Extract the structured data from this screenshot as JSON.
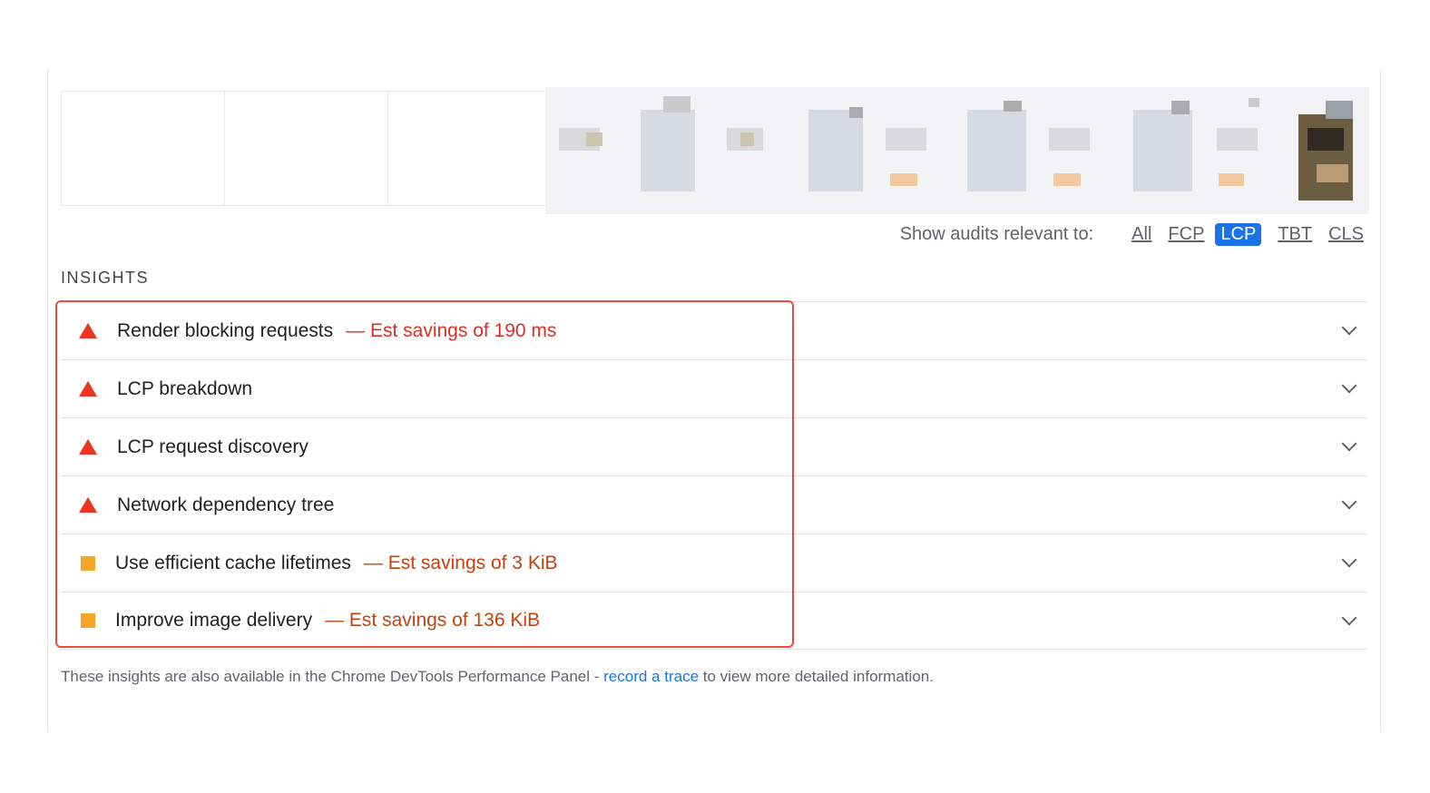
{
  "filter": {
    "label": "Show audits relevant to:",
    "options": [
      "All",
      "FCP",
      "LCP",
      "TBT",
      "CLS"
    ],
    "active": "LCP"
  },
  "section_title": "INSIGHTS",
  "insights": [
    {
      "severity": "fail",
      "title": "Render blocking requests",
      "savings": "— Est savings of 190 ms"
    },
    {
      "severity": "fail",
      "title": "LCP breakdown",
      "savings": ""
    },
    {
      "severity": "fail",
      "title": "LCP request discovery",
      "savings": ""
    },
    {
      "severity": "fail",
      "title": "Network dependency tree",
      "savings": ""
    },
    {
      "severity": "average",
      "title": "Use efficient cache lifetimes",
      "savings": "— Est savings of 3 KiB"
    },
    {
      "severity": "average",
      "title": "Improve image delivery",
      "savings": "— Est savings of 136 KiB"
    }
  ],
  "footer": {
    "prefix": "These insights are also available in the Chrome DevTools Performance Panel - ",
    "link": "record a trace",
    "suffix": " to view more detailed information."
  },
  "colors": {
    "fail": "#eb3323",
    "average": "#f7a529",
    "highlight": "#ea4b3a",
    "accent": "#1a73e8"
  }
}
